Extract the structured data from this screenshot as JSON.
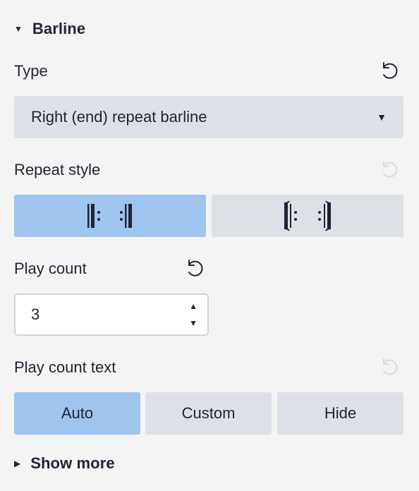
{
  "section": {
    "title": "Barline",
    "expanded": true
  },
  "type": {
    "label": "Type",
    "value": "Right (end) repeat barline"
  },
  "repeat_style": {
    "label": "Repeat style",
    "options": [
      {
        "name": "normal-repeat",
        "selected": true
      },
      {
        "name": "bracketed-repeat",
        "selected": false
      }
    ]
  },
  "play_count": {
    "label": "Play count",
    "value": "3"
  },
  "play_count_text": {
    "label": "Play count text",
    "options": [
      "Auto",
      "Custom",
      "Hide"
    ],
    "selected": "Auto"
  },
  "show_more": {
    "label": "Show more"
  },
  "colors": {
    "background": "#f4f4f4",
    "selected": "#9dc5ee",
    "unselected": "#dde1e7",
    "text": "#1f2433",
    "disabled_icon": "#d9dbe0"
  }
}
